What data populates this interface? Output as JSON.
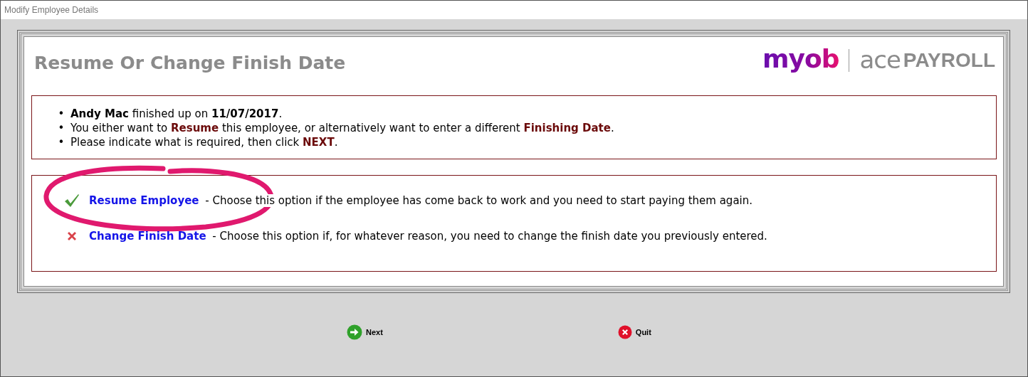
{
  "window": {
    "title": "Modify Employee Details"
  },
  "heading": "Resume Or Change Finish Date",
  "logo": {
    "brand": "myob",
    "product": "ace",
    "suffix": "PAYROLL"
  },
  "info": [
    {
      "bullet": "•",
      "segments": [
        {
          "text": "Andy Mac",
          "kind": "bold"
        },
        {
          "text": " finished up on ",
          "kind": "plain"
        },
        {
          "text": "11/07/2017",
          "kind": "bold"
        },
        {
          "text": ".",
          "kind": "plain"
        }
      ]
    },
    {
      "bullet": "•",
      "segments": [
        {
          "text": "You either want to ",
          "kind": "plain"
        },
        {
          "text": "Resume",
          "kind": "emphasis"
        },
        {
          "text": " this employee, or alternatively want to enter a different ",
          "kind": "plain"
        },
        {
          "text": "Finishing Date",
          "kind": "emphasis"
        },
        {
          "text": ".",
          "kind": "plain"
        }
      ]
    },
    {
      "bullet": "•",
      "segments": [
        {
          "text": "Please indicate what is required, then click ",
          "kind": "plain"
        },
        {
          "text": "NEXT",
          "kind": "emphasis"
        },
        {
          "text": ".",
          "kind": "plain"
        }
      ]
    }
  ],
  "options": [
    {
      "kind": "check",
      "link": "Resume Employee",
      "description": "- Choose this option if the employee has come back to work and you need to start paying them again.",
      "highlighted": true
    },
    {
      "kind": "cross",
      "link": "Change Finish Date",
      "description": "- Choose this option if, for whatever reason, you need to change the finish date you previously entered.",
      "highlighted": false
    }
  ],
  "buttons": [
    {
      "kind": "next",
      "label": "Next"
    },
    {
      "kind": "quit",
      "label": "Quit"
    }
  ]
}
